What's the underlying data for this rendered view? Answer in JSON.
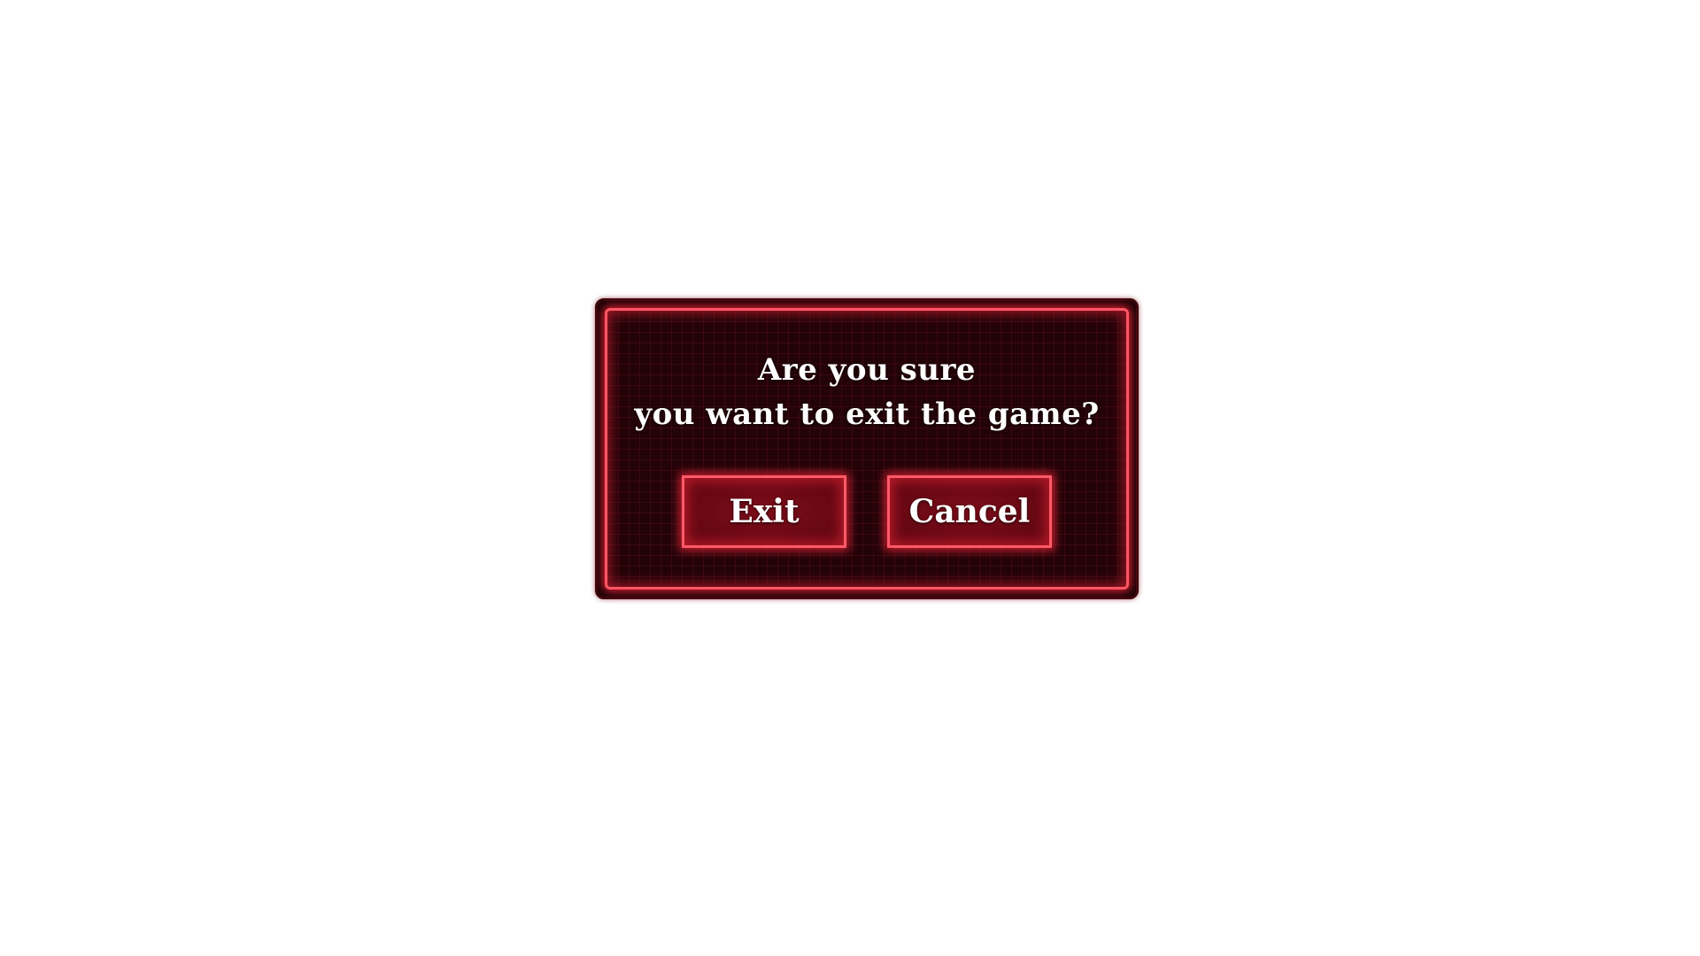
{
  "dialog": {
    "message_line1": "Are you sure",
    "message_line2": "you want to exit the game?",
    "exit_label": "Exit",
    "cancel_label": "Cancel"
  },
  "colors": {
    "background": "#ffffff",
    "panel": "#230308",
    "border_glow": "#ff5563",
    "button_fill": "#6a0814",
    "text": "#ffffff"
  }
}
